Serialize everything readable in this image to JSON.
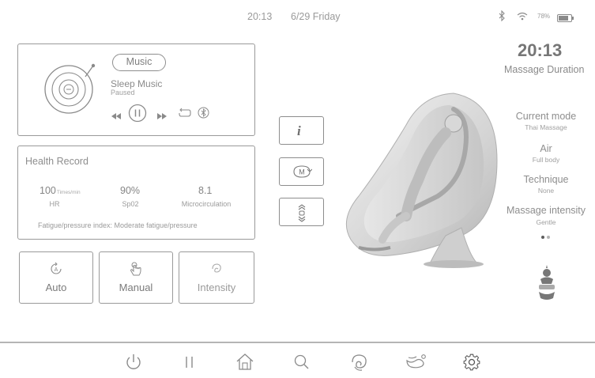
{
  "status_bar": {
    "time": "20:13",
    "date": "6/29 Friday",
    "battery": "78%",
    "icons": [
      "bluetooth-icon",
      "wifi-icon",
      "battery-icon"
    ]
  },
  "music": {
    "pill_label": "Music",
    "title": "Sleep Music",
    "state": "Paused",
    "controls": [
      "prev-icon",
      "pause-icon",
      "next-icon",
      "repeat-icon",
      "bluetooth-icon"
    ]
  },
  "health": {
    "title": "Health Record",
    "metrics": [
      {
        "value": "100",
        "unit": "Times/min",
        "label": "HR"
      },
      {
        "value": "90%",
        "unit": "",
        "label": "Sp02"
      },
      {
        "value": "8.1",
        "unit": "",
        "label": "Microcirculation"
      }
    ],
    "fatigue": "Fatigue/pressure index: Moderate fatigue/pressure"
  },
  "modes": [
    {
      "label": "Auto",
      "icon": "auto-icon"
    },
    {
      "label": "Manual",
      "icon": "manual-hand-icon"
    },
    {
      "label": "Intensity",
      "icon": "intensity-icon"
    }
  ],
  "side_buttons": [
    "info-icon",
    "mode-switch-icon",
    "position-adjust-icon"
  ],
  "session": {
    "time": "20:13",
    "duration_label": "Massage Duration",
    "current_mode_label": "Current mode",
    "current_mode_value": "Thai Massage",
    "air_label": "Air",
    "air_value": "Full body",
    "technique_label": "Technique",
    "technique_value": "None",
    "intensity_label": "Massage intensity",
    "intensity_value": "Gentle"
  },
  "bottom_nav": [
    "power-icon",
    "pause-icon",
    "home-icon",
    "search-icon",
    "massage-hand-icon",
    "foot-icon",
    "settings-gear-icon"
  ],
  "colors": {
    "text": "#8a8a8a",
    "border": "#9a9a9a",
    "background": "#ffffff"
  }
}
